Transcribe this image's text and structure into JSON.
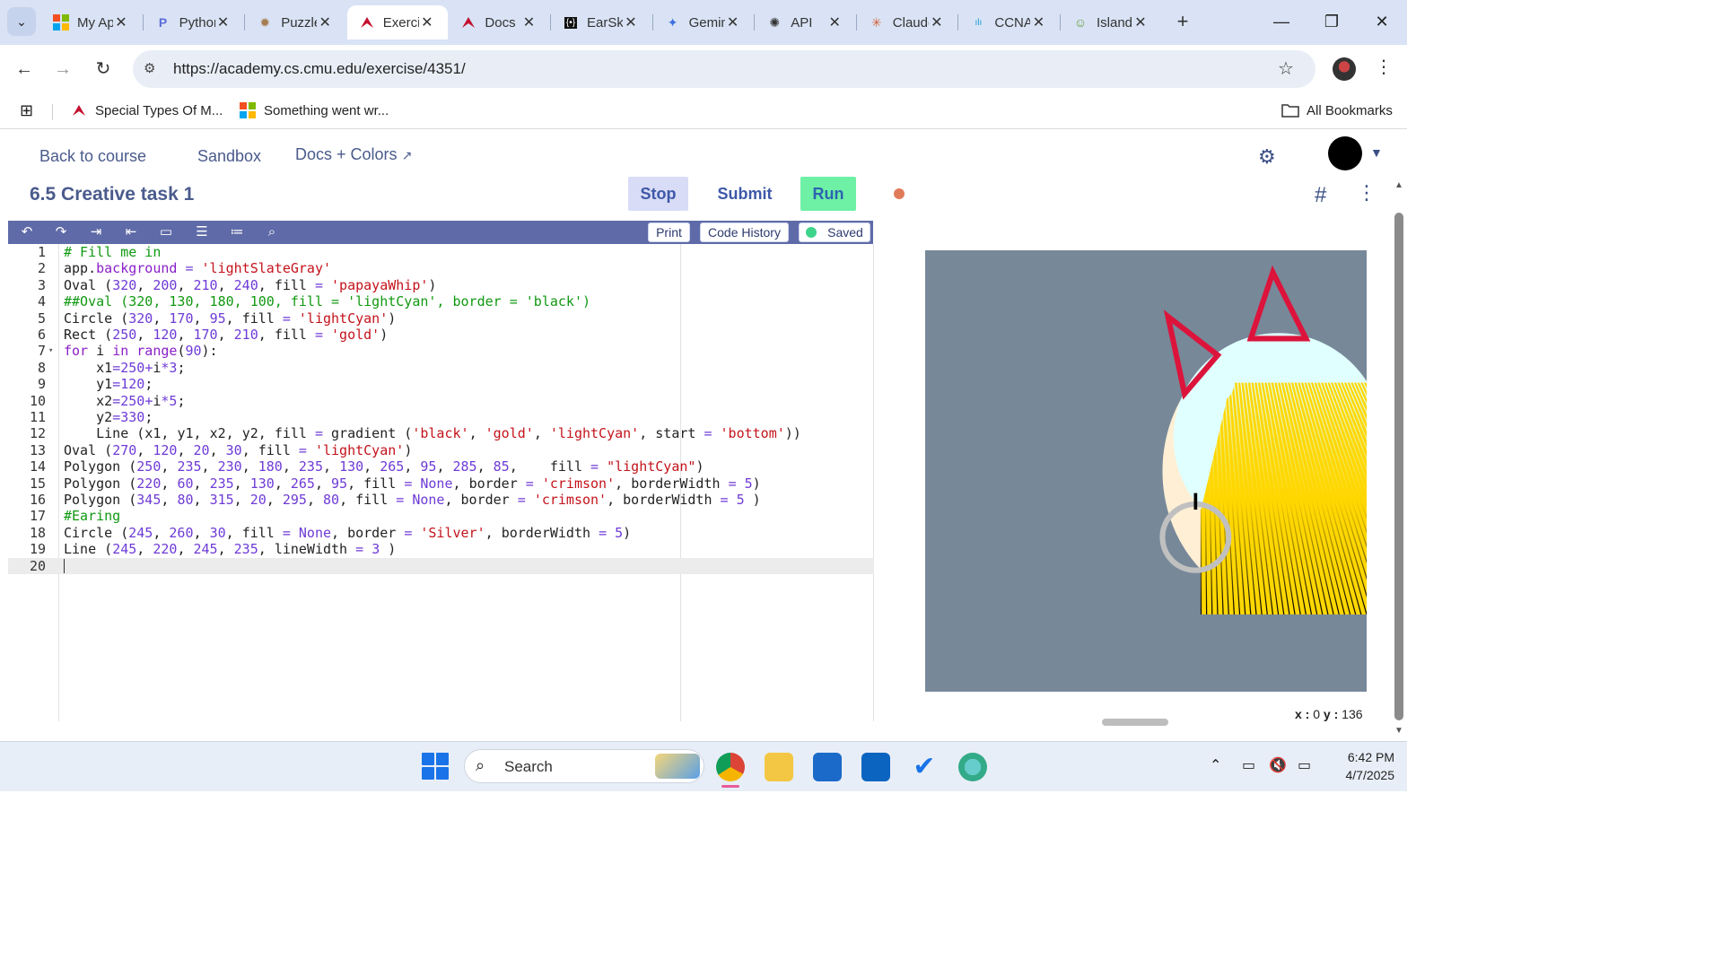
{
  "browser": {
    "tabs": [
      {
        "title": "My Apps",
        "icon": "microsoft-icon"
      },
      {
        "title": "Python",
        "icon": "p-icon"
      },
      {
        "title": "Puzzle",
        "icon": "puzzle-icon"
      },
      {
        "title": "Exercise",
        "icon": "cmu-dragon-icon",
        "active": true
      },
      {
        "title": "Docs",
        "icon": "cmu-dragon-icon"
      },
      {
        "title": "EarSketch",
        "icon": "earsketch-icon"
      },
      {
        "title": "Gemini",
        "icon": "gemini-icon"
      },
      {
        "title": "API",
        "icon": "openai-icon"
      },
      {
        "title": "Claude",
        "icon": "claude-icon"
      },
      {
        "title": "CCNA",
        "icon": "cisco-icon"
      },
      {
        "title": "Island",
        "icon": "island-icon"
      }
    ],
    "url": "https://academy.cs.cmu.edu/exercise/4351/",
    "bookmarks": [
      {
        "label": "Special Types Of M...",
        "icon": "cmu-dragon-icon"
      },
      {
        "label": "Something went wr...",
        "icon": "microsoft-icon"
      }
    ],
    "all_bookmarks": "All Bookmarks"
  },
  "app": {
    "nav": {
      "back": "Back to course",
      "sandbox": "Sandbox",
      "docs": "Docs + Colors"
    },
    "task_title": "6.5 Creative task 1",
    "buttons": {
      "stop": "Stop",
      "submit": "Submit",
      "run": "Run"
    },
    "editor_toolbar": {
      "print": "Print",
      "history": "Code History",
      "saved": "Saved"
    },
    "code_lines": [
      "# Fill me in",
      "app.background = 'lightSlateGray'",
      "Oval (320, 200, 210, 240, fill = 'papayaWhip')",
      "##Oval (320, 130, 180, 100, fill = 'lightCyan', border = 'black')",
      "Circle (320, 170, 95, fill = 'lightCyan')",
      "Rect (250, 120, 170, 210, fill = 'gold')",
      "for i in range(90):",
      "    x1=250+i*3;",
      "    y1=120;",
      "    x2=250+i*5;",
      "    y2=330;",
      "    Line (x1, y1, x2, y2, fill = gradient ('black', 'gold', 'lightCyan', start = 'bottom'))",
      "Oval (270, 120, 20, 30, fill = 'lightCyan')",
      "Polygon (250, 235, 230, 180, 235, 130, 265, 95, 285, 85,    fill = \"lightCyan\")",
      "Polygon (220, 60, 235, 130, 265, 95, fill = None, border = 'crimson', borderWidth = 5)",
      "Polygon (345, 80, 315, 20, 295, 80, fill = None, border = 'crimson', borderWidth = 5 )",
      "#Earing",
      "Circle (245, 260, 30, fill = None, border = 'Silver', borderWidth = 5)",
      "Line (245, 220, 245, 235, lineWidth = 3 )",
      ""
    ],
    "coords": {
      "x_label": "x :",
      "x": "0",
      "y_label": "y :",
      "y": "136"
    },
    "colors": {
      "canvas_bg": "#778899",
      "papaya": "#ffefd5",
      "cyan": "#e0ffff",
      "gold": "#ffd700",
      "crimson": "#dc143c",
      "silver": "#c0c0c0"
    }
  },
  "taskbar": {
    "search": "Search",
    "time": "6:42 PM",
    "date": "4/7/2025"
  }
}
